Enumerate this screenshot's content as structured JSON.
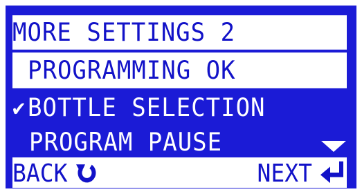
{
  "menu": {
    "title": "MORE SETTINGS 2",
    "items": [
      {
        "label": "PROGRAMMING OK",
        "highlighted": true,
        "checked": false
      },
      {
        "label": "BOTTLE SELECTION",
        "highlighted": false,
        "checked": true,
        "check_glyph": "✔"
      },
      {
        "label": "PROGRAM PAUSE",
        "highlighted": false,
        "checked": false
      }
    ],
    "scroll_indicator_icon": "down-triangle-icon"
  },
  "footer": {
    "back_label": "BACK",
    "back_icon": "back-arrow-icon",
    "next_label": "NEXT",
    "next_icon": "enter-arrow-icon"
  },
  "colors": {
    "screen_bg": "#1b1bd6",
    "highlight_bg": "#ffffff",
    "highlight_text": "#1212c8",
    "text": "#ffffff"
  }
}
